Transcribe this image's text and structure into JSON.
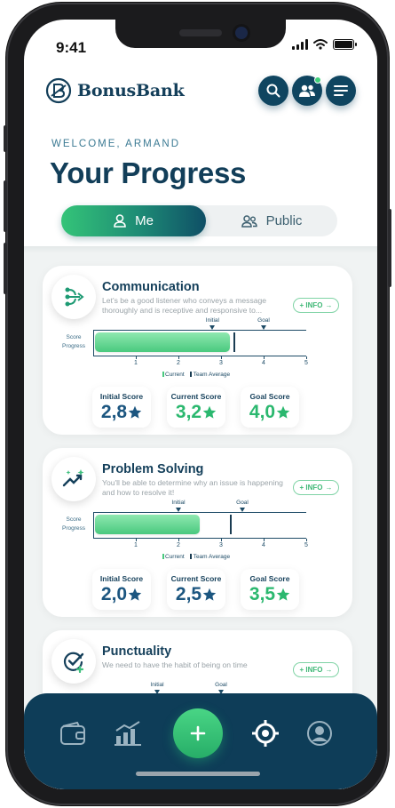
{
  "status_bar": {
    "time": "9:41"
  },
  "brand": {
    "name": "BonusBank"
  },
  "header": {
    "welcome": "WELCOME, ARMAND",
    "title": "Your Progress"
  },
  "toggle": {
    "me": "Me",
    "public": "Public",
    "selected": "Me"
  },
  "chart_labels": {
    "score_progress": "Score Progress",
    "initial": "Initial",
    "goal": "Goal",
    "current": "Current",
    "team_average": "Team Average",
    "info": "+ INFO",
    "initial_score": "Initial Score",
    "current_score": "Current Score",
    "goal_score": "Goal Score"
  },
  "chart_data": {
    "type": "bar",
    "x_ticks": [
      "1",
      "2",
      "3",
      "4",
      "5"
    ],
    "xlim": [
      0,
      5
    ],
    "cards": [
      {
        "title": "Communication",
        "description": "Let's be a good listener who conveys a message thoroughly and is receptive and responsive to...",
        "initial": 2.8,
        "current": 3.2,
        "goal": 4.0,
        "team_average": 3.3,
        "initial_display": "2,8",
        "current_display": "3,2",
        "goal_display": "4,0"
      },
      {
        "title": "Problem Solving",
        "description": "You'll be able to determine why an issue is happening and how to resolve it!",
        "initial": 2.0,
        "current": 2.5,
        "goal": 3.5,
        "team_average": 3.2,
        "initial_display": "2,0",
        "current_display": "2,5",
        "goal_display": "3,5"
      },
      {
        "title": "Punctuality",
        "description": "We need to have the habit of being on time",
        "initial": 1.5,
        "goal": 3.0
      }
    ]
  },
  "colors": {
    "primary": "#0e3d58",
    "accent_green": "#3fb876",
    "initial_score": "#1c5680",
    "current_score": "#2bb86f",
    "goal_score": "#2bb86f"
  },
  "nav": {
    "items": [
      "wallet-icon",
      "chart-icon",
      "plus-icon",
      "target-icon",
      "profile-icon"
    ],
    "active": "target-icon"
  }
}
